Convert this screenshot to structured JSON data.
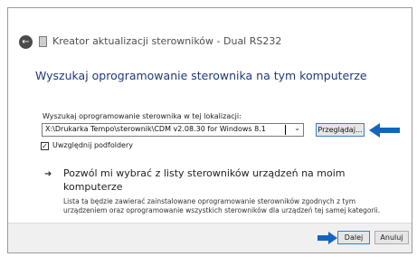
{
  "window": {
    "title": "Kreator aktualizacji sterowników - Dual RS232",
    "heading": "Wyszukaj oprogramowanie sterownika na tym komputerze"
  },
  "search": {
    "label": "Wyszukaj oprogramowanie sterownika w tej lokalizacji:",
    "path_value": "X:\\Drukarka Tempo\\sterownik\\CDM v2.08.30 for Windows 8.1",
    "browse_label": "Przeglądaj...",
    "subfolders_label": "Uwzględnij podfoldery",
    "subfolders_checked": true
  },
  "pick": {
    "title": "Pozwól mi wybrać z listy sterowników urządzeń na moim komputerze",
    "description": "Lista ta będzie zawierać zainstalowane oprogramowanie sterowników zgodnych z tym urządzeniem oraz oprogramowanie wszystkich sterowników dla urządzeń tej samej kategorii."
  },
  "footer": {
    "next_label": "Dalej",
    "cancel_label": "Anuluj"
  },
  "colors": {
    "accent": "#3c7fc9",
    "annotation_arrow": "#1565c0",
    "heading": "#1f3a78"
  }
}
